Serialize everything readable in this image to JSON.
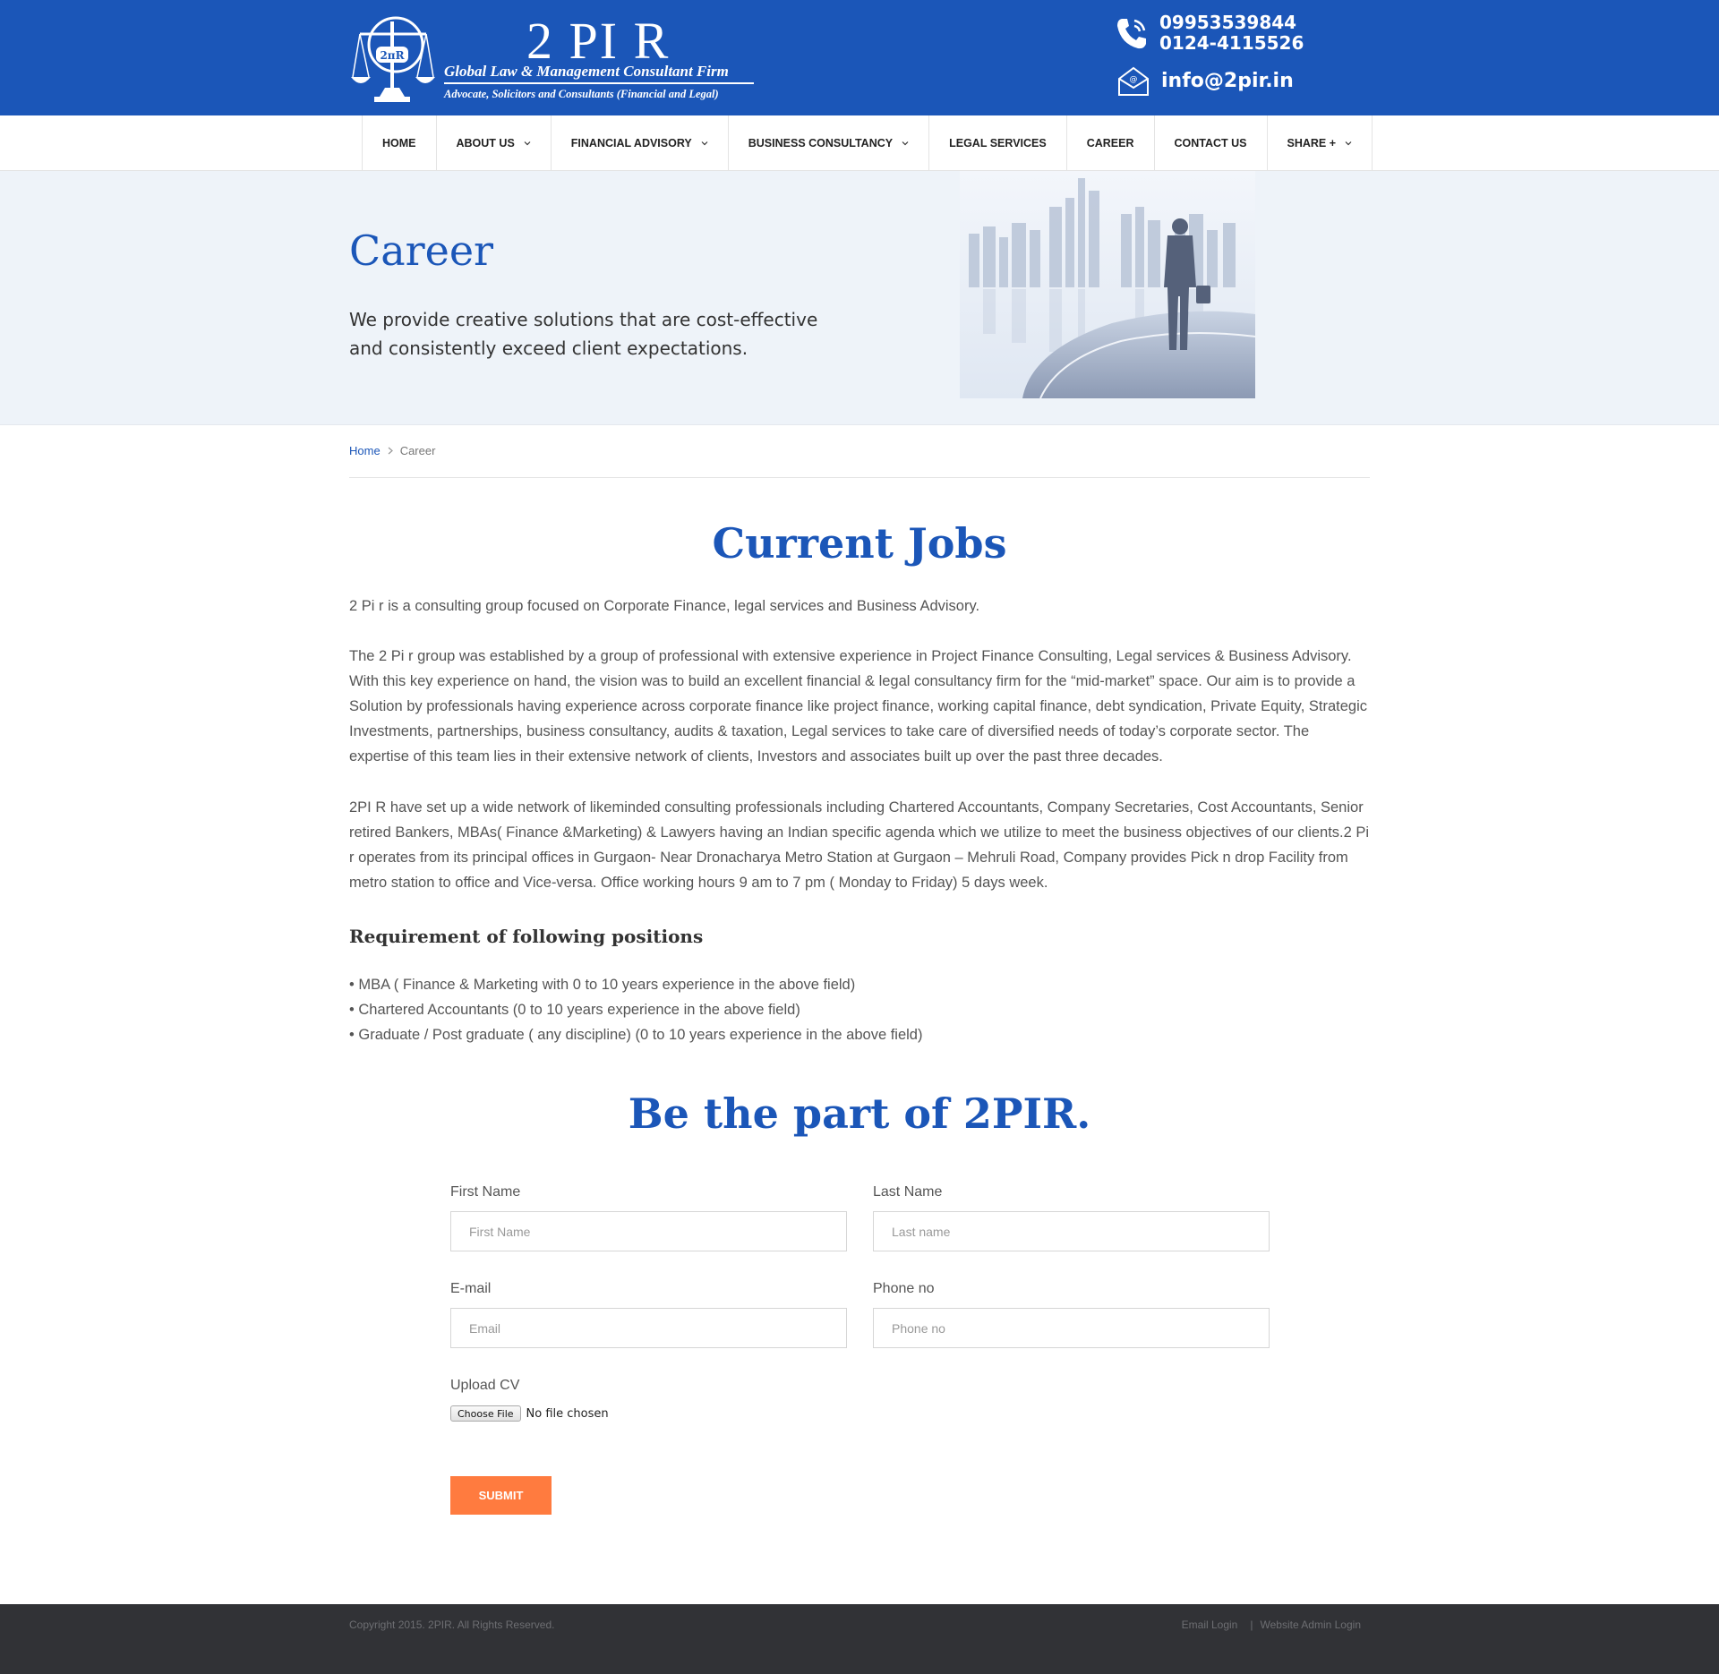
{
  "header": {
    "logo_title": "2 PI R",
    "logo_tagline": "Global Law & Management Consultant Firm",
    "logo_subtagline": "Advocate, Solicitors and Consultants (Financial and Legal)",
    "emblem_text": "2πR",
    "phone_1": "09953539844",
    "phone_2": "0124-4115526",
    "email": "info@2pir.in",
    "brand_color": "#1b56b8"
  },
  "nav": {
    "items": [
      {
        "label": "HOME",
        "dropdown": false
      },
      {
        "label": "ABOUT US",
        "dropdown": true
      },
      {
        "label": "FINANCIAL ADVISORY",
        "dropdown": true
      },
      {
        "label": "BUSINESS CONSULTANCY",
        "dropdown": true
      },
      {
        "label": "LEGAL SERVICES",
        "dropdown": false
      },
      {
        "label": "CAREER",
        "dropdown": false
      },
      {
        "label": "CONTACT US",
        "dropdown": false
      },
      {
        "label": "SHARE +",
        "dropdown": true
      }
    ]
  },
  "hero": {
    "title": "Career",
    "text": "We provide creative solutions that are cost-effective and consistently exceed client expectations."
  },
  "breadcrumb": {
    "home": "Home",
    "current": "Career"
  },
  "content": {
    "title": "Current Jobs",
    "para_1": "2 Pi r is a consulting group focused on Corporate Finance, legal services and Business Advisory.",
    "para_2": "The 2 Pi r group was established by a group of professional with extensive experience in Project Finance Consulting, Legal services & Business Advisory. With this key experience on hand, the vision was to build an excellent financial & legal consultancy firm for the “mid-market” space. Our aim is to provide a Solution by professionals having experience across corporate finance like project finance, working capital finance, debt syndication, Private Equity, Strategic Investments, partnerships, business consultancy, audits & taxation, Legal services to take care of diversified needs of today’s corporate sector. The expertise of this team lies in their extensive network of clients, Investors and associates built up over the past three decades.",
    "para_3": "2PI R have set up a wide network of likeminded consulting professionals including Chartered Accountants, Company Secretaries, Cost Accountants, Senior retired Bankers, MBAs( Finance &Marketing) & Lawyers having an Indian specific agenda which we utilize to meet the business objectives of our clients.2 Pi r operates from its principal offices in Gurgaon- Near Dronacharya Metro Station at Gurgaon – Mehruli Road, Company provides Pick n drop Facility from metro station to office and Vice-versa. Office working hours 9 am to 7 pm ( Monday to Friday) 5 days week.",
    "requirements_title": "Requirement of following positions",
    "requirements": [
      "• MBA ( Finance & Marketing with 0 to 10 years experience in the above field)",
      "• Chartered Accountants (0 to 10 years experience in the above field)",
      "• Graduate / Post graduate ( any discipline) (0 to 10 years experience in the above field)"
    ]
  },
  "form": {
    "title": "Be the part of 2PIR.",
    "first_name_label": "First Name",
    "first_name_placeholder": "First Name",
    "first_name_value": "",
    "last_name_label": "Last Name",
    "last_name_placeholder": "Last name",
    "last_name_value": "",
    "email_label": "E-mail",
    "email_placeholder": "Email",
    "email_value": "",
    "phone_label": "Phone no",
    "phone_placeholder": "Phone no",
    "phone_value": "",
    "cv_label": "Upload CV",
    "file_button": "Choose File",
    "file_status": "No file chosen",
    "submit_label": "SUBMIT",
    "submit_color": "#ff7b3f"
  },
  "footer": {
    "copyright": "Copyright 2015. 2PIR. All Rights Reserved.",
    "email_login": "Email Login",
    "separator": "|",
    "admin_login": "Website Admin Login"
  }
}
